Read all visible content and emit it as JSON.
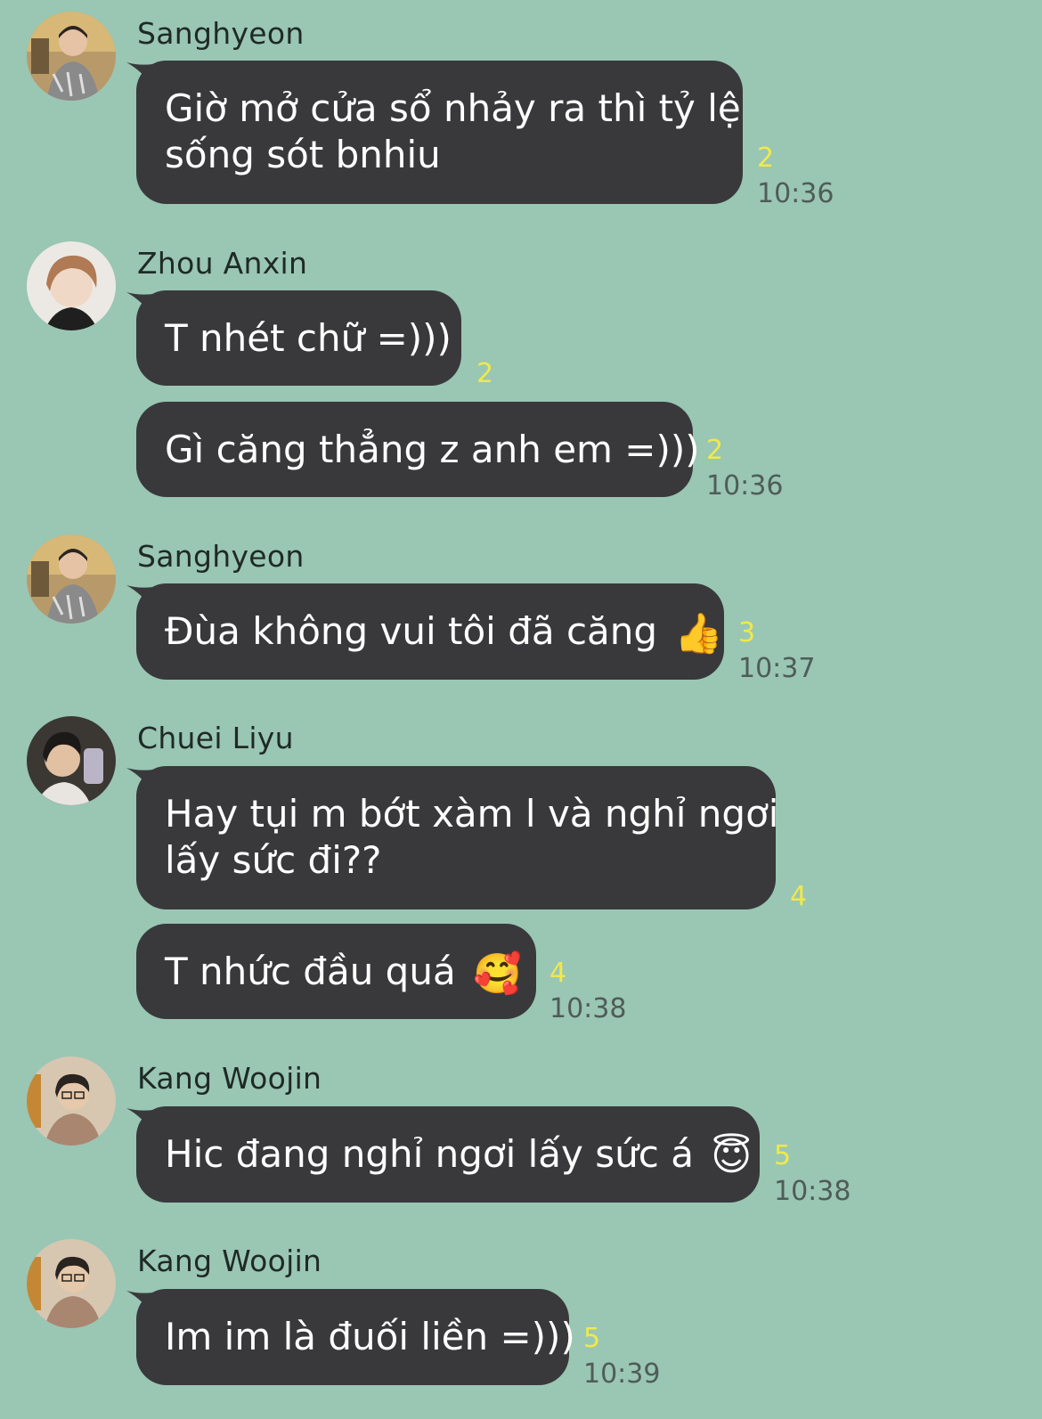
{
  "messages": [
    {
      "sender": "Sanghyeon",
      "lines": [
        "Giờ mở cửa sổ nhảy ra thì tỷ lệ",
        "sống sót bnhiu"
      ],
      "read": "2",
      "time": "10:36"
    },
    {
      "sender": "Zhou Anxin",
      "text": "T nhét chữ =)))",
      "read": "2"
    },
    {
      "text": "Gì căng thẳng z anh em =)))",
      "read": "2",
      "time": "10:36"
    },
    {
      "sender": "Sanghyeon",
      "text": "Đùa không vui tôi đã căng",
      "emoji": "👍",
      "emoji_icon": "thumbs-up-icon",
      "read": "3",
      "time": "10:37"
    },
    {
      "sender": "Chuei Liyu",
      "lines": [
        "Hay tụi m bớt xàm l và nghỉ ngơi",
        "lấy sức đi??"
      ],
      "read": "4"
    },
    {
      "text": "T nhức đầu quá",
      "emoji": "🥰",
      "emoji_icon": "smiling-face-with-hearts-icon",
      "read": "4",
      "time": "10:38"
    },
    {
      "sender": "Kang Woojin",
      "text": "Hic đang nghỉ ngơi lấy sức á",
      "emoji": "😇",
      "emoji_icon": "halo-face-icon",
      "read": "5",
      "time": "10:38"
    },
    {
      "sender": "Kang Woojin",
      "text": "Im im là đuối liền =)))",
      "read": "5",
      "time": "10:39"
    }
  ],
  "colors": {
    "background": "#9ac6b4",
    "bubble": "#39393b",
    "bubble_text": "#ffffff",
    "read_count": "#f1e94a",
    "time": "#4f5c57"
  }
}
